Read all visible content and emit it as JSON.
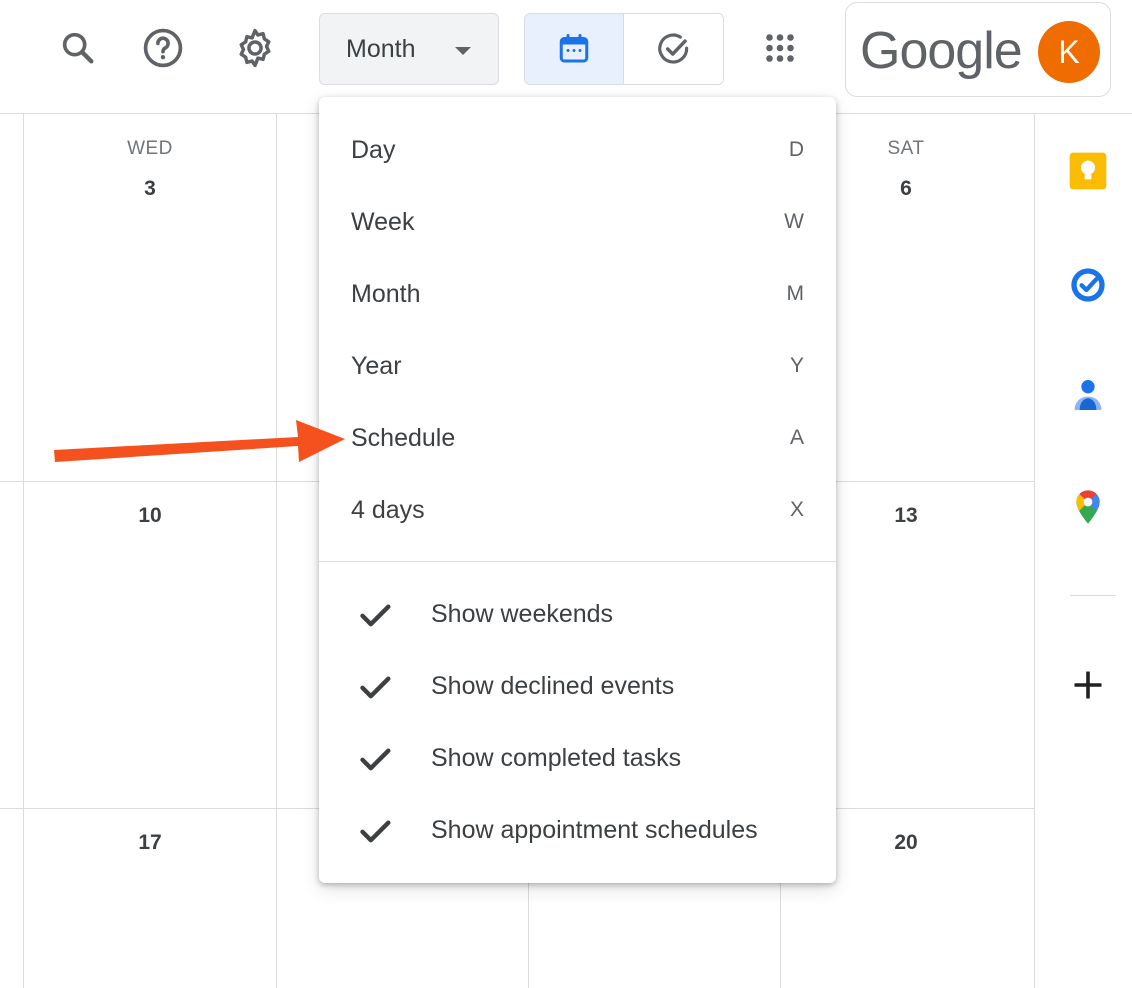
{
  "header": {
    "view_label": "Month",
    "brand": "Google",
    "avatar_initial": "K"
  },
  "grid": {
    "week1": {
      "wed_dow": "WED",
      "wed_num": "3",
      "sat_dow": "SAT",
      "sat_num": "6"
    },
    "week2": {
      "wed_num": "10",
      "sat_num": "13"
    },
    "week3": {
      "wed_num": "17",
      "sat_num": "20"
    }
  },
  "menu": {
    "views": [
      {
        "label": "Day",
        "key": "D"
      },
      {
        "label": "Week",
        "key": "W"
      },
      {
        "label": "Month",
        "key": "M"
      },
      {
        "label": "Year",
        "key": "Y"
      },
      {
        "label": "Schedule",
        "key": "A"
      },
      {
        "label": "4 days",
        "key": "X"
      }
    ],
    "options": [
      {
        "label": "Show weekends",
        "checked": true
      },
      {
        "label": "Show declined events",
        "checked": true
      },
      {
        "label": "Show completed tasks",
        "checked": true
      },
      {
        "label": "Show appointment schedules",
        "checked": true
      }
    ]
  },
  "icons": {
    "header": [
      "search-icon",
      "help-icon",
      "settings-gear-icon",
      "calendar-icon",
      "tasks-check-icon",
      "apps-grid-icon"
    ],
    "side": [
      "keep-icon",
      "tasks-icon",
      "contacts-icon",
      "maps-icon",
      "plus-icon"
    ]
  },
  "colors": {
    "accent_blue": "#1a73e8",
    "avatar": "#ef6c00",
    "annotation_arrow": "#f4511e",
    "keep_yellow": "#fbbc04"
  }
}
